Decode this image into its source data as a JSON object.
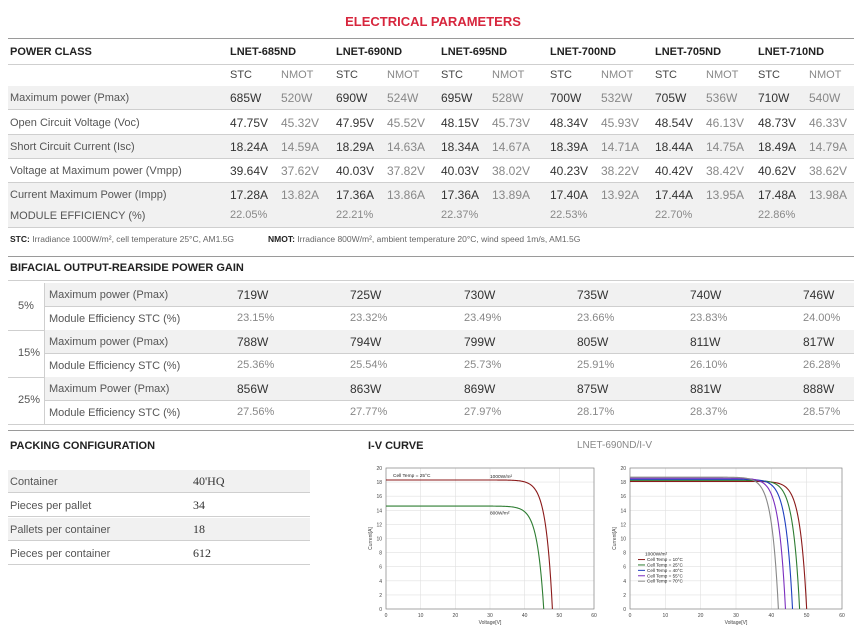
{
  "title": "ELECTRICAL PARAMETERS",
  "power_class_label": "POWER CLASS",
  "models": [
    "LNET-685ND",
    "LNET-690ND",
    "LNET-695ND",
    "LNET-700ND",
    "LNET-705ND",
    "LNET-710ND"
  ],
  "stc": "STC",
  "nmot": "NMOT",
  "params": [
    {
      "label": "Maximum power (Pmax)",
      "values": [
        "685W",
        "520W",
        "690W",
        "524W",
        "695W",
        "528W",
        "700W",
        "532W",
        "705W",
        "536W",
        "710W",
        "540W"
      ]
    },
    {
      "label": "Open Circuit Voltage (Voc)",
      "values": [
        "47.75V",
        "45.32V",
        "47.95V",
        "45.52V",
        "48.15V",
        "45.73V",
        "48.34V",
        "45.93V",
        "48.54V",
        "46.13V",
        "48.73V",
        "46.33V"
      ]
    },
    {
      "label": "Short Circuit Current (Isc)",
      "values": [
        "18.24A",
        "14.59A",
        "18.29A",
        "14.63A",
        "18.34A",
        "14.67A",
        "18.39A",
        "14.71A",
        "18.44A",
        "14.75A",
        "18.49A",
        "14.79A"
      ]
    },
    {
      "label": "Voltage at Maximum power (Vmpp)",
      "values": [
        "39.64V",
        "37.62V",
        "40.03V",
        "37.82V",
        "40.03V",
        "38.02V",
        "40.23V",
        "38.22V",
        "40.42V",
        "38.42V",
        "40.62V",
        "38.62V"
      ]
    },
    {
      "label": "Current Maximum Power (Impp)",
      "values": [
        "17.28A",
        "13.82A",
        "17.36A",
        "13.86A",
        "17.36A",
        "13.89A",
        "17.40A",
        "13.92A",
        "17.44A",
        "13.95A",
        "17.48A",
        "13.98A"
      ]
    }
  ],
  "efficiency": {
    "label": "MODULE EFFICIENCY (%)",
    "values": [
      "22.05%",
      "22.21%",
      "22.37%",
      "22.53%",
      "22.70%",
      "22.86%"
    ]
  },
  "stc_note": {
    "bold": "STC:",
    "text": " Irradiance 1000W/m², cell temperature 25°C, AM1.5G"
  },
  "nmot_note": {
    "bold": "NMOT:",
    "text": " Irradiance 800W/m², ambient temperature 20°C, wind speed 1m/s, AM1.5G"
  },
  "bifacial": {
    "title": "BIFACIAL OUTPUT-REARSIDE POWER GAIN",
    "groups": [
      {
        "gain": "5%",
        "rows": [
          {
            "label": "Maximum power (Pmax)",
            "values": [
              "719W",
              "725W",
              "730W",
              "735W",
              "740W",
              "746W"
            ]
          },
          {
            "label": "Module Efficiency STC (%)",
            "values": [
              "23.15%",
              "23.32%",
              "23.49%",
              "23.66%",
              "23.83%",
              "24.00%"
            ]
          }
        ]
      },
      {
        "gain": "15%",
        "rows": [
          {
            "label": "Maximum power (Pmax)",
            "values": [
              "788W",
              "794W",
              "799W",
              "805W",
              "811W",
              "817W"
            ]
          },
          {
            "label": "Module Efficiency STC (%)",
            "values": [
              "25.36%",
              "25.54%",
              "25.73%",
              "25.91%",
              "26.10%",
              "26.28%"
            ]
          }
        ]
      },
      {
        "gain": "25%",
        "rows": [
          {
            "label": "Maximum Power (Pmax)",
            "values": [
              "856W",
              "863W",
              "869W",
              "875W",
              "881W",
              "888W"
            ]
          },
          {
            "label": "Module Efficiency STC (%)",
            "values": [
              "27.56%",
              "27.77%",
              "27.97%",
              "28.17%",
              "28.37%",
              "28.57%"
            ]
          }
        ]
      }
    ]
  },
  "packing": {
    "title": "PACKING CONFIGURATION",
    "rows": [
      {
        "label": "Container",
        "value": "40'HQ"
      },
      {
        "label": "Pieces per pallet",
        "value": "34"
      },
      {
        "label": "Pallets per container",
        "value": "18"
      },
      {
        "label": "Pieces per container",
        "value": "612"
      }
    ]
  },
  "iv": {
    "title": "I-V CURVE",
    "subtitle": "LNET-690ND/I-V",
    "colors": {
      "accent": "#d7263d",
      "dark_red": "#8b1a1a",
      "green": "#2e7d32",
      "blue": "#1f3fbf",
      "purple": "#7b2fbf",
      "grey": "#888888"
    },
    "chart_data": [
      {
        "type": "line",
        "xlabel": "Voltage[V]",
        "ylabel": "Current[A]",
        "xlim": [
          0,
          60
        ],
        "ylim": [
          0,
          20
        ],
        "x_ticks": [
          "0",
          "10",
          "20",
          "30",
          "40",
          "50",
          "60"
        ],
        "y_ticks": [
          "0",
          "2",
          "4",
          "6",
          "8",
          "10",
          "12",
          "14",
          "16",
          "18",
          "20"
        ],
        "annotation": "Cell Temp = 25°C",
        "series": [
          {
            "name": "1000W/m²",
            "color": "#8b1a1a",
            "isc": 18.3,
            "voc": 48
          },
          {
            "name": "800W/m²",
            "color": "#2e7d32",
            "isc": 14.6,
            "voc": 45.5
          }
        ]
      },
      {
        "type": "line",
        "xlabel": "Voltage[V]",
        "ylabel": "Current[A]",
        "xlim": [
          0,
          60
        ],
        "ylim": [
          0,
          20
        ],
        "x_ticks": [
          "0",
          "10",
          "20",
          "30",
          "40",
          "50",
          "60"
        ],
        "y_ticks": [
          "0",
          "2",
          "4",
          "6",
          "8",
          "10",
          "12",
          "14",
          "16",
          "18",
          "20"
        ],
        "annotation": "1000W/m²",
        "series": [
          {
            "name": "Cell Temp = 10°C",
            "color": "#8b1a1a",
            "isc": 18.1,
            "voc": 50
          },
          {
            "name": "Cell Temp = 25°C",
            "color": "#2e7d32",
            "isc": 18.25,
            "voc": 48
          },
          {
            "name": "Cell Temp = 40°C",
            "color": "#1f3fbf",
            "isc": 18.4,
            "voc": 46
          },
          {
            "name": "Cell Temp = 55°C",
            "color": "#7b2fbf",
            "isc": 18.55,
            "voc": 44
          },
          {
            "name": "Cell Temp = 70°C",
            "color": "#888888",
            "isc": 18.7,
            "voc": 42
          }
        ]
      }
    ]
  }
}
